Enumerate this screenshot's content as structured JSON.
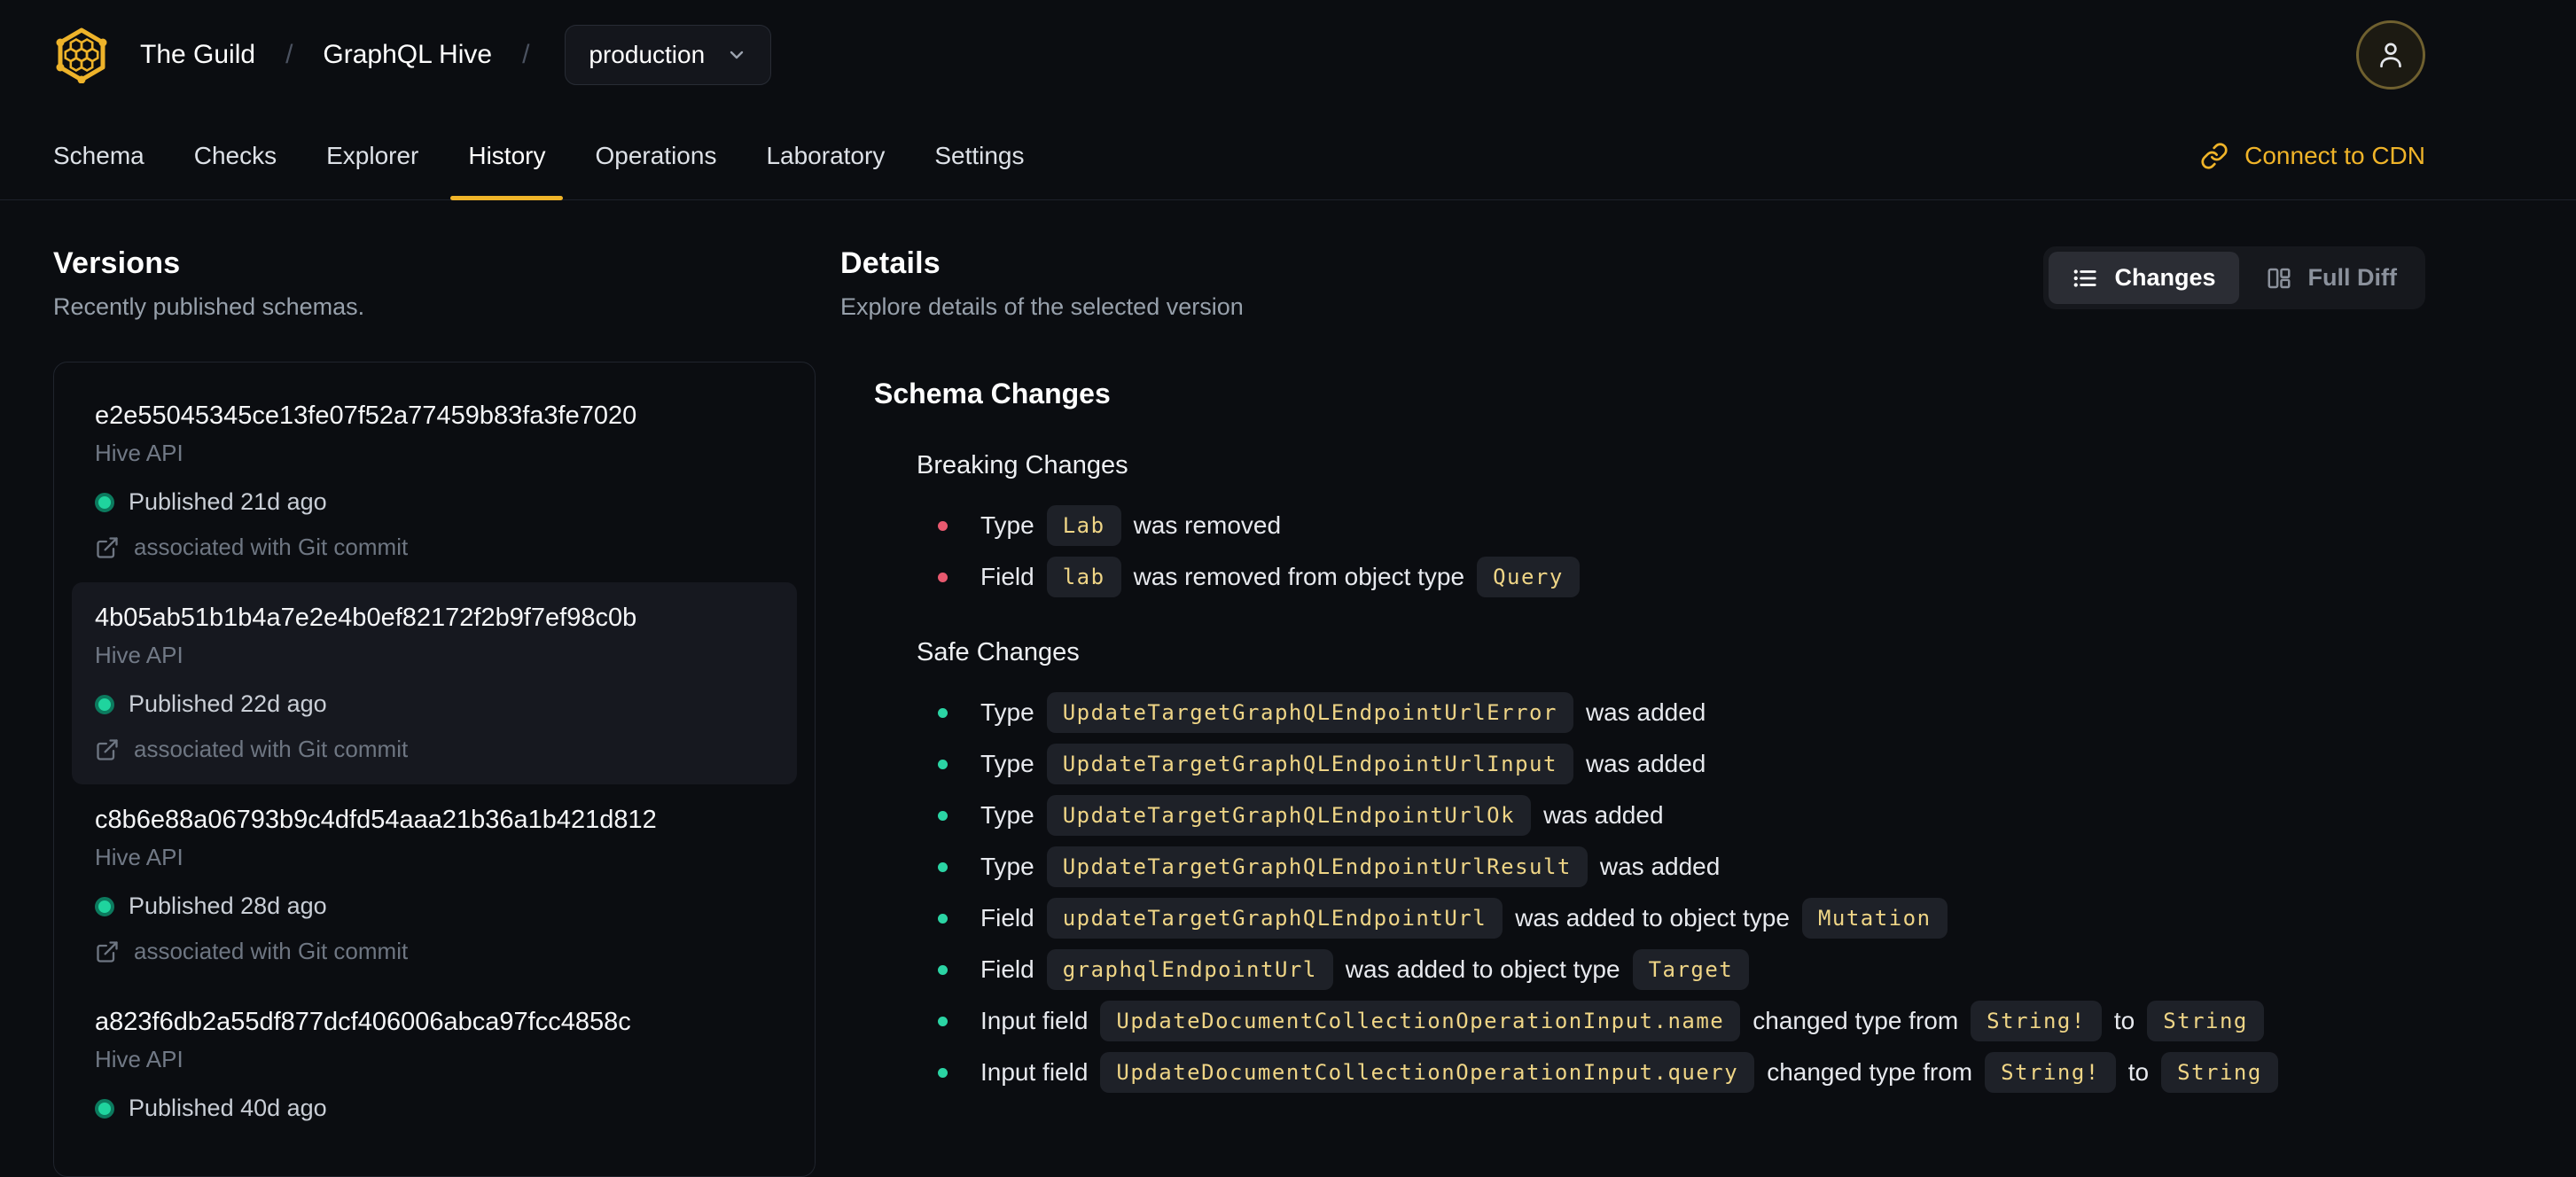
{
  "colors": {
    "accent": "#f0b429",
    "breaking": "#e8596f",
    "safe": "#2bd4a4",
    "chip-text": "#efd586",
    "published-dot": "#1fd49e"
  },
  "header": {
    "breadcrumb": {
      "org": "The Guild",
      "separator": "/",
      "project": "GraphQL Hive"
    },
    "target_selector": {
      "value": "production"
    },
    "tabs": [
      {
        "label": "Schema",
        "active": false
      },
      {
        "label": "Checks",
        "active": false
      },
      {
        "label": "Explorer",
        "active": false
      },
      {
        "label": "History",
        "active": true
      },
      {
        "label": "Operations",
        "active": false
      },
      {
        "label": "Laboratory",
        "active": false
      },
      {
        "label": "Settings",
        "active": false
      }
    ],
    "connect_cdn_label": "Connect to CDN"
  },
  "versions": {
    "title": "Versions",
    "subtitle": "Recently published schemas.",
    "items": [
      {
        "hash": "e2e55045345ce13fe07f52a77459b83fa3fe7020",
        "service": "Hive API",
        "published": "Published 21d ago",
        "git": "associated with Git commit",
        "selected": false
      },
      {
        "hash": "4b05ab51b1b4a7e2e4b0ef82172f2b9f7ef98c0b",
        "service": "Hive API",
        "published": "Published 22d ago",
        "git": "associated with Git commit",
        "selected": true
      },
      {
        "hash": "c8b6e88a06793b9c4dfd54aaa21b36a1b421d812",
        "service": "Hive API",
        "published": "Published 28d ago",
        "git": "associated with Git commit",
        "selected": false
      },
      {
        "hash": "a823f6db2a55df877dcf406006abca97fcc4858c",
        "service": "Hive API",
        "published": "Published 40d ago",
        "git": "",
        "selected": false
      }
    ]
  },
  "details": {
    "title": "Details",
    "subtitle": "Explore details of the selected version",
    "view_toggle": {
      "changes_label": "Changes",
      "full_diff_label": "Full Diff",
      "active": "Changes"
    },
    "schema_changes": {
      "title": "Schema Changes",
      "groups": [
        {
          "title": "Breaking Changes",
          "severity": "breaking",
          "items": [
            [
              {
                "text": "Type"
              },
              {
                "code": "Lab"
              },
              {
                "text": "was removed"
              }
            ],
            [
              {
                "text": "Field"
              },
              {
                "code": "lab"
              },
              {
                "text": "was removed from object type"
              },
              {
                "code": "Query"
              }
            ]
          ]
        },
        {
          "title": "Safe Changes",
          "severity": "safe",
          "items": [
            [
              {
                "text": "Type"
              },
              {
                "code": "UpdateTargetGraphQLEndpointUrlError"
              },
              {
                "text": "was added"
              }
            ],
            [
              {
                "text": "Type"
              },
              {
                "code": "UpdateTargetGraphQLEndpointUrlInput"
              },
              {
                "text": "was added"
              }
            ],
            [
              {
                "text": "Type"
              },
              {
                "code": "UpdateTargetGraphQLEndpointUrlOk"
              },
              {
                "text": "was added"
              }
            ],
            [
              {
                "text": "Type"
              },
              {
                "code": "UpdateTargetGraphQLEndpointUrlResult"
              },
              {
                "text": "was added"
              }
            ],
            [
              {
                "text": "Field"
              },
              {
                "code": "updateTargetGraphQLEndpointUrl"
              },
              {
                "text": "was added to object type"
              },
              {
                "code": "Mutation"
              }
            ],
            [
              {
                "text": "Field"
              },
              {
                "code": "graphqlEndpointUrl"
              },
              {
                "text": "was added to object type"
              },
              {
                "code": "Target"
              }
            ],
            [
              {
                "text": "Input field"
              },
              {
                "code": "UpdateDocumentCollectionOperationInput.name"
              },
              {
                "text": "changed type from"
              },
              {
                "code": "String!"
              },
              {
                "text": "to"
              },
              {
                "code": "String"
              }
            ],
            [
              {
                "text": "Input field"
              },
              {
                "code": "UpdateDocumentCollectionOperationInput.query"
              },
              {
                "text": "changed type from"
              },
              {
                "code": "String!"
              },
              {
                "text": "to"
              },
              {
                "code": "String"
              }
            ]
          ]
        }
      ]
    }
  }
}
